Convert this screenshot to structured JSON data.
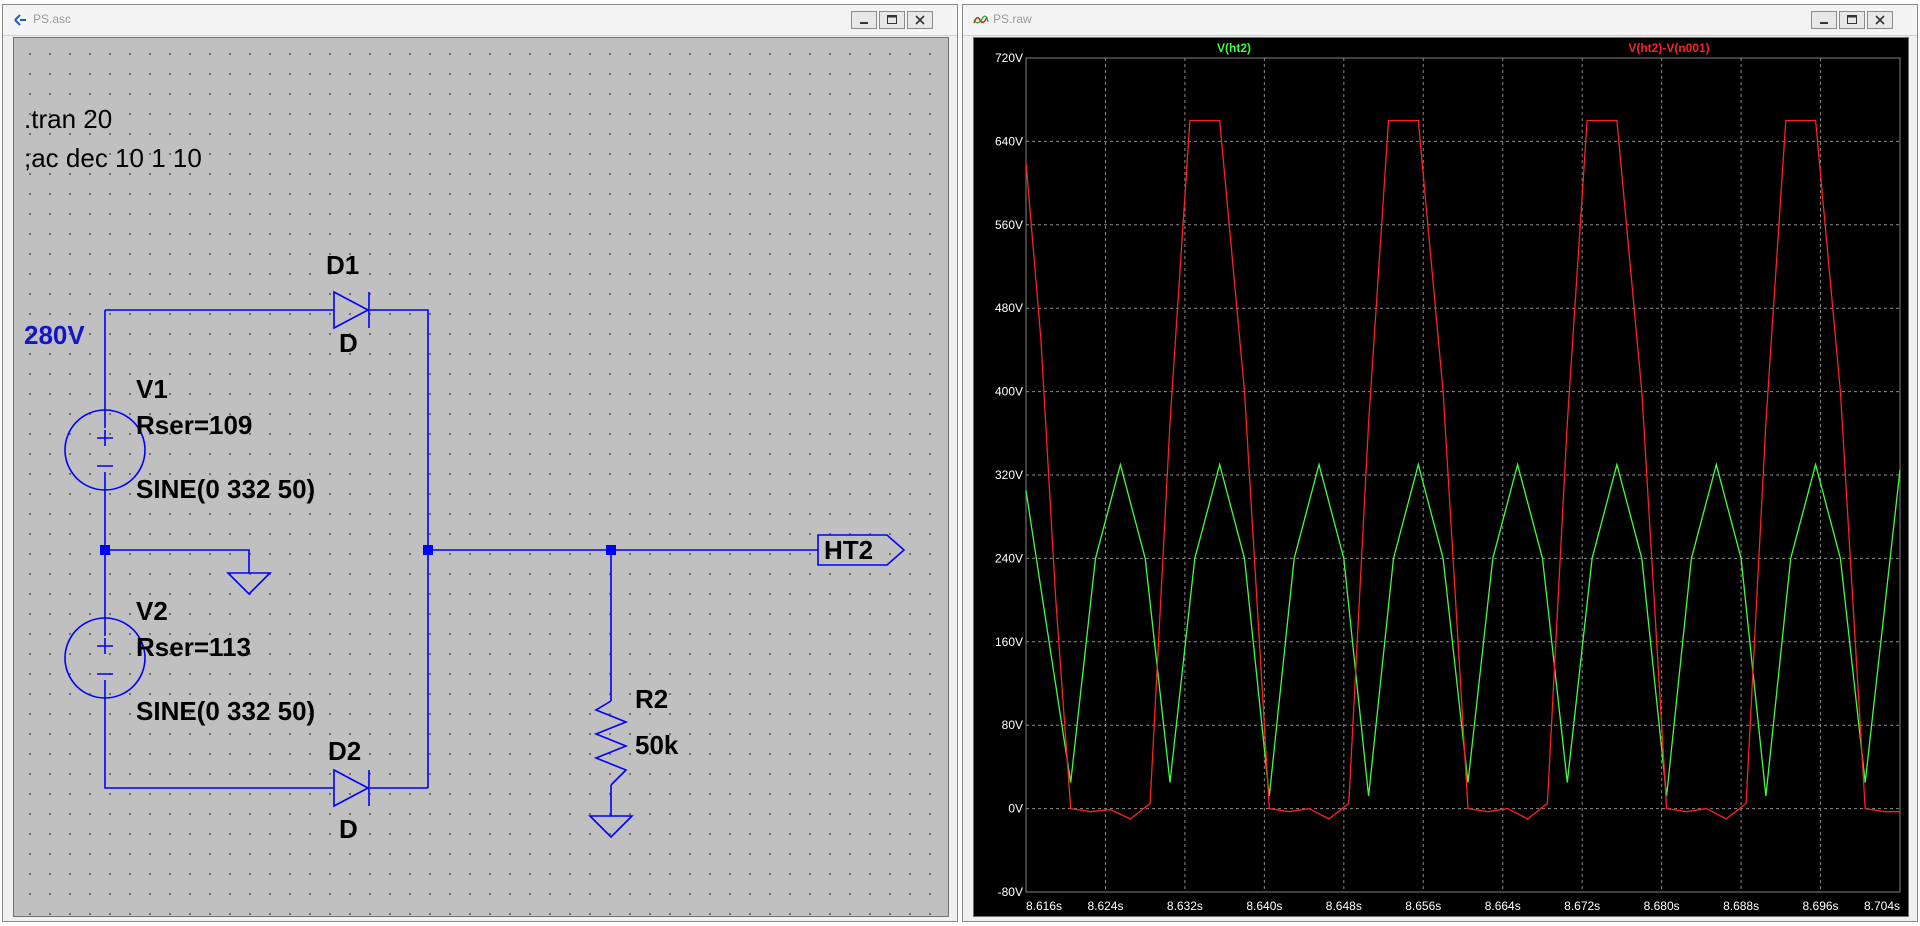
{
  "schematic_window": {
    "title": "PS.asc",
    "directives": [
      ".tran 20",
      ";ac dec 10 1 10"
    ],
    "net_label_280": "280V",
    "components": {
      "d1": {
        "ref": "D1",
        "model": "D"
      },
      "d2": {
        "ref": "D2",
        "model": "D"
      },
      "v1": {
        "ref": "V1",
        "param": "Rser=109",
        "value": "SINE(0 332 50)"
      },
      "v2": {
        "ref": "V2",
        "param": "Rser=113",
        "value": "SINE(0 332 50)"
      },
      "r2": {
        "ref": "R2",
        "value": "50k"
      },
      "ht2": {
        "label": "HT2"
      }
    },
    "colors": {
      "wire": "#0000ff",
      "label": "#1414c8",
      "background": "#c0c0c0"
    }
  },
  "waveform_window": {
    "title": "PS.raw",
    "chart_data": {
      "type": "line",
      "x_unit": "s",
      "y_unit": "V",
      "xlim": [
        8.616,
        8.704
      ],
      "ylim": [
        -80,
        720
      ],
      "x_ticks": [
        "8.616s",
        "8.624s",
        "8.632s",
        "8.640s",
        "8.648s",
        "8.656s",
        "8.664s",
        "8.672s",
        "8.680s",
        "8.688s",
        "8.696s",
        "8.704s"
      ],
      "y_ticks": [
        "720V",
        "640V",
        "560V",
        "480V",
        "400V",
        "320V",
        "240V",
        "160V",
        "80V",
        "0V",
        "-80V"
      ],
      "grid": true,
      "legend_placement": "top",
      "series": [
        {
          "name": "V(ht2)",
          "color": "#3cff3c",
          "x": [
            8.616,
            8.618,
            8.6205,
            8.623,
            8.6255,
            8.628,
            8.6305,
            8.633,
            8.6355,
            8.638,
            8.6405,
            8.643,
            8.6455,
            8.648,
            8.6505,
            8.653,
            8.6555,
            8.658,
            8.6605,
            8.663,
            8.6655,
            8.668,
            8.6705,
            8.673,
            8.6755,
            8.678,
            8.6805,
            8.683,
            8.6855,
            8.688,
            8.6905,
            8.693,
            8.6955,
            8.698,
            8.7005,
            8.704
          ],
          "y": [
            305,
            180,
            25,
            240,
            330,
            240,
            25,
            240,
            330,
            240,
            12,
            240,
            330,
            240,
            12,
            240,
            330,
            240,
            25,
            240,
            330,
            240,
            25,
            240,
            330,
            240,
            12,
            240,
            330,
            240,
            12,
            240,
            330,
            240,
            25,
            325
          ]
        },
        {
          "name": "V(ht2)-V(n001)",
          "color": "#ff2020",
          "x": [
            8.616,
            8.6175,
            8.619,
            8.6205,
            8.6225,
            8.6245,
            8.6265,
            8.6285,
            8.6305,
            8.6325,
            8.6355,
            8.638,
            8.6405,
            8.6425,
            8.6445,
            8.6465,
            8.6485,
            8.6505,
            8.6525,
            8.6555,
            8.658,
            8.6605,
            8.6625,
            8.6645,
            8.6665,
            8.6685,
            8.6705,
            8.6725,
            8.6755,
            8.678,
            8.6805,
            8.6825,
            8.6845,
            8.6865,
            8.6885,
            8.6905,
            8.6925,
            8.6955,
            8.698,
            8.7005,
            8.7025,
            8.704
          ],
          "y": [
            620,
            450,
            200,
            0,
            -3,
            -1,
            -10,
            5,
            370,
            660,
            660,
            400,
            0,
            -3,
            0,
            -10,
            5,
            370,
            660,
            660,
            400,
            0,
            -3,
            0,
            -10,
            5,
            370,
            660,
            660,
            400,
            0,
            -3,
            0,
            -10,
            5,
            370,
            660,
            660,
            400,
            0,
            -3,
            -3
          ]
        }
      ]
    }
  }
}
